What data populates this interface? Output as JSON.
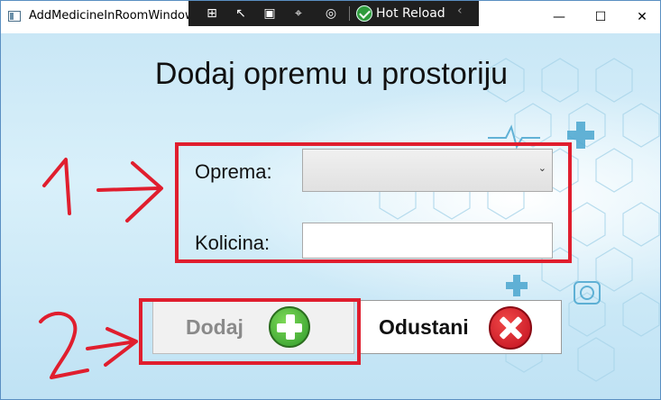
{
  "window": {
    "title": "AddMedicineInRoomWindow",
    "controls": {
      "minimize": "—",
      "maximize": "☐",
      "close": "✕"
    }
  },
  "devtools": {
    "hot_reload_label": "Hot Reload",
    "collapse_glyph": "‹"
  },
  "form": {
    "heading": "Dodaj opremu u prostoriju",
    "equipment_label": "Oprema:",
    "equipment_selected": "",
    "quantity_label": "Kolicina:",
    "quantity_value": ""
  },
  "buttons": {
    "add_label": "Dodaj",
    "cancel_label": "Odustani"
  },
  "colors": {
    "annotation_red": "#e01e2e",
    "add_green": "#2e9a2a",
    "cancel_red": "#c10f1e"
  }
}
